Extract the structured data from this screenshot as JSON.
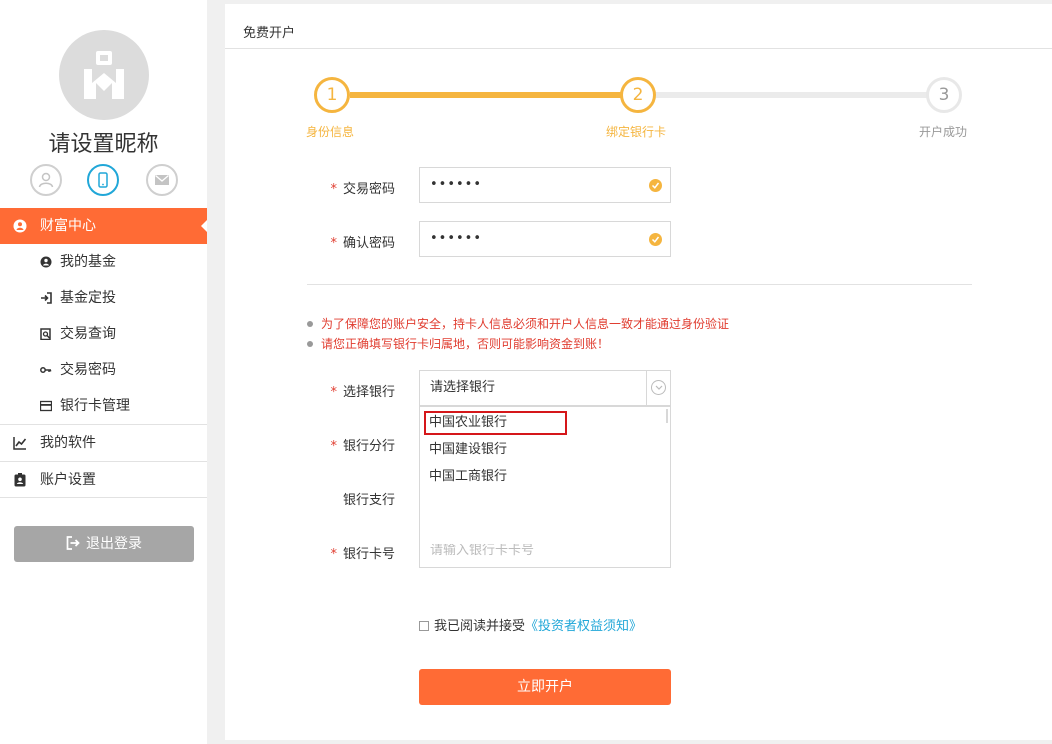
{
  "sidebar": {
    "nickname": "请设置昵称",
    "menu": {
      "wealth_center": "财富中心",
      "sub_items": [
        "我的基金",
        "基金定投",
        "交易查询",
        "交易密码",
        "银行卡管理"
      ],
      "my_software": "我的软件",
      "account_settings": "账户设置"
    },
    "logout_label": "退出登录"
  },
  "main": {
    "title": "免费开户",
    "steps": [
      {
        "number": "1",
        "label": "身份信息",
        "status": "done"
      },
      {
        "number": "2",
        "label": "绑定银行卡",
        "status": "current"
      },
      {
        "number": "3",
        "label": "开户成功",
        "status": "todo"
      }
    ],
    "form": {
      "trade_password_label": "交易密码",
      "trade_password_value": "••••••",
      "confirm_password_label": "确认密码",
      "confirm_password_value": "••••••",
      "notices": [
        "为了保障您的账户安全，持卡人信息必须和开户人信息一致才能通过身份验证",
        "请您正确填写银行卡归属地，否则可能影响资金到账！"
      ],
      "select_bank_label": "选择银行",
      "select_bank_value": "请选择银行",
      "bank_options": [
        "中国农业银行",
        "中国建设银行",
        "中国工商银行"
      ],
      "bank_branch_label": "银行分行",
      "bank_sub_branch_label": "银行支行",
      "card_number_label": "银行卡号",
      "card_number_placeholder": "请输入银行卡卡号",
      "agree_text": "我已阅读并接受",
      "agree_link": "《投资者权益须知》",
      "submit_label": "立即开户",
      "required_mark": "*"
    }
  },
  "colors": {
    "accent": "#ff6b35",
    "step_done": "#f5b53f",
    "link": "#21a7d8",
    "error": "#e03c2f",
    "highlight_box": "#d5171a"
  }
}
